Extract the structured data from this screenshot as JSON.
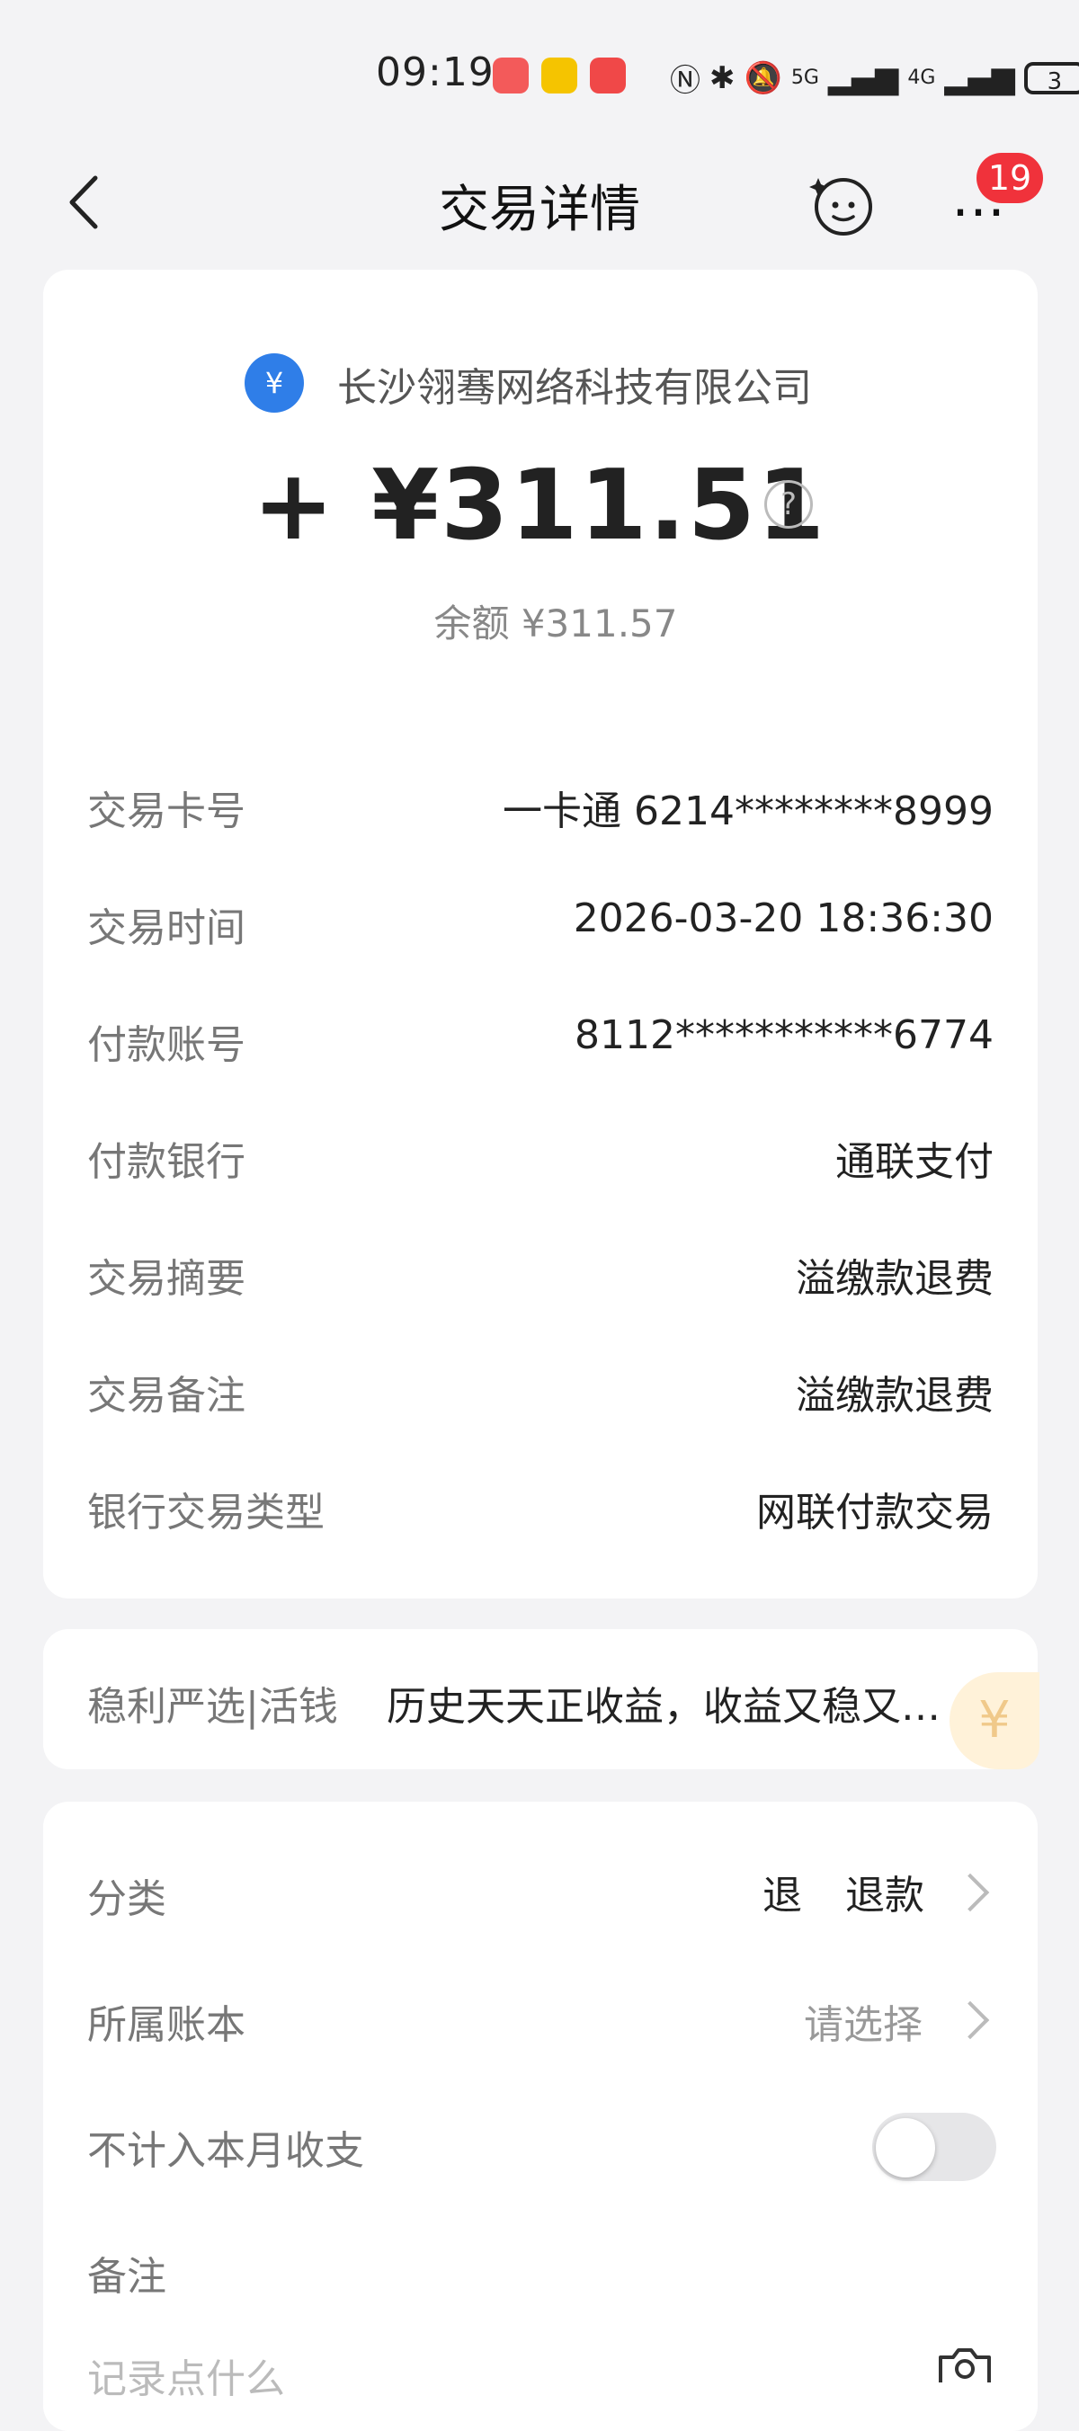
{
  "status_bar": {
    "time": "09:19",
    "battery_level": "3",
    "network": [
      "5G",
      "4G"
    ]
  },
  "header": {
    "title": "交易详情",
    "notification_count": "19",
    "more_label": "⋯"
  },
  "summary": {
    "merchant_name": "长沙翎骞网络科技有限公司",
    "logo_glyph": "¥",
    "amount": "+ ¥311.51",
    "balance": "余额 ¥311.57",
    "help_glyph": "?"
  },
  "details": [
    {
      "label": "交易卡号",
      "value": "一卡通 6214********8999"
    },
    {
      "label": "交易时间",
      "value": "2026-03-20 18:36:30"
    },
    {
      "label": "付款账号",
      "value": "8112***********6774"
    },
    {
      "label": "付款银行",
      "value": "通联支付"
    },
    {
      "label": "交易摘要",
      "value": "溢缴款退费"
    },
    {
      "label": "交易备注",
      "value": "溢缴款退费"
    },
    {
      "label": "银行交易类型",
      "value": "网联付款交易"
    }
  ],
  "promo": {
    "label": "稳利严选|活钱",
    "text": "历史天天正收益，收益又稳又…",
    "deco_glyph": "¥"
  },
  "settings": {
    "category_label": "分类",
    "category_icon": "退",
    "category_value": "退款",
    "account_book_label": "所属账本",
    "account_book_value": "请选择",
    "exclude_label": "不计入本月收支",
    "exclude_enabled": false,
    "note_label": "备注",
    "note_placeholder": "记录点什么"
  },
  "colors": {
    "badge": "#f0323b",
    "logo": "#2f7ee8",
    "background": "#f3f3f5"
  }
}
